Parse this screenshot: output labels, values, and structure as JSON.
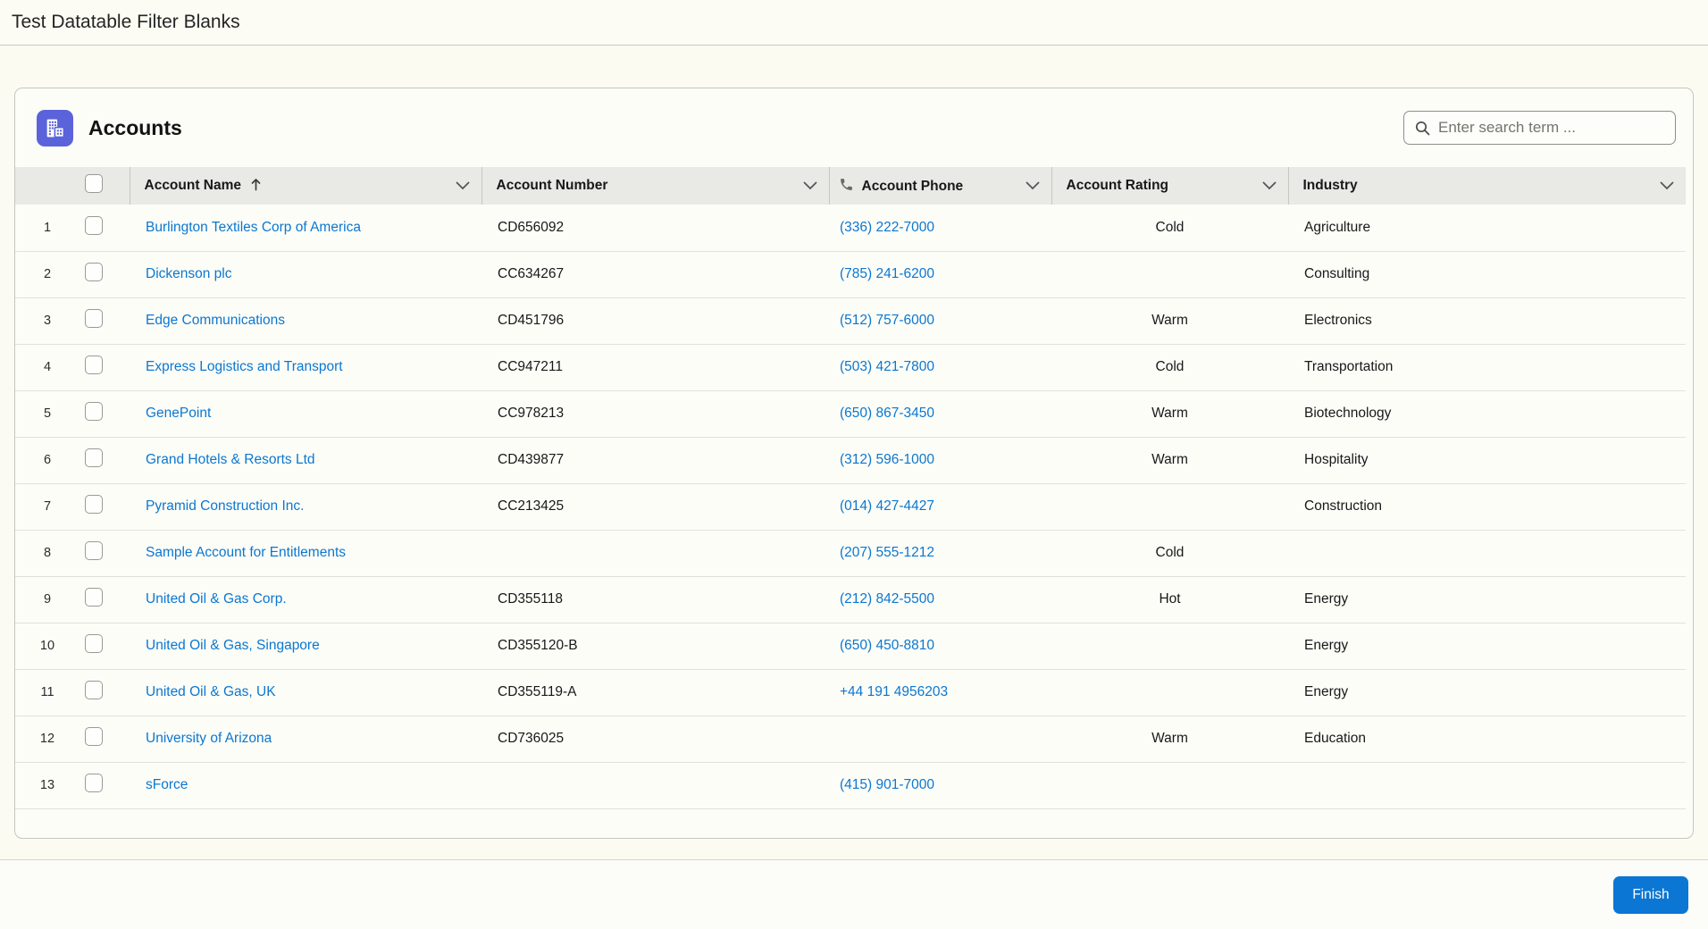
{
  "page": {
    "title": "Test Datatable Filter Blanks"
  },
  "card": {
    "title": "Accounts",
    "icon": "accounts-buildings-icon",
    "icon_bg_color": "#5b63db",
    "search_placeholder": "Enter search term ..."
  },
  "table": {
    "columns": [
      {
        "key": "name",
        "label": "Account Name",
        "sorted": "ascending",
        "icon": "sort-ascending-icon"
      },
      {
        "key": "number",
        "label": "Account Number"
      },
      {
        "key": "phone",
        "label": "Account Phone",
        "icon": "phone-icon"
      },
      {
        "key": "rating",
        "label": "Account Rating"
      },
      {
        "key": "industry",
        "label": "Industry"
      }
    ],
    "rows": [
      {
        "num": "1",
        "name": "Burlington Textiles Corp of America",
        "number": "CD656092",
        "phone": "(336) 222-7000",
        "rating": "Cold",
        "industry": "Agriculture"
      },
      {
        "num": "2",
        "name": "Dickenson plc",
        "number": "CC634267",
        "phone": "(785) 241-6200",
        "rating": "",
        "industry": "Consulting"
      },
      {
        "num": "3",
        "name": "Edge Communications",
        "number": "CD451796",
        "phone": "(512) 757-6000",
        "rating": "Warm",
        "industry": "Electronics"
      },
      {
        "num": "4",
        "name": "Express Logistics and Transport",
        "number": "CC947211",
        "phone": "(503) 421-7800",
        "rating": "Cold",
        "industry": "Transportation"
      },
      {
        "num": "5",
        "name": "GenePoint",
        "number": "CC978213",
        "phone": "(650) 867-3450",
        "rating": "Warm",
        "industry": "Biotechnology"
      },
      {
        "num": "6",
        "name": "Grand Hotels & Resorts Ltd",
        "number": "CD439877",
        "phone": "(312) 596-1000",
        "rating": "Warm",
        "industry": "Hospitality"
      },
      {
        "num": "7",
        "name": "Pyramid Construction Inc.",
        "number": "CC213425",
        "phone": "(014) 427-4427",
        "rating": "",
        "industry": "Construction"
      },
      {
        "num": "8",
        "name": "Sample Account for Entitlements",
        "number": "",
        "phone": "(207) 555-1212",
        "rating": "Cold",
        "industry": ""
      },
      {
        "num": "9",
        "name": "United Oil & Gas Corp.",
        "number": "CD355118",
        "phone": "(212) 842-5500",
        "rating": "Hot",
        "industry": "Energy"
      },
      {
        "num": "10",
        "name": "United Oil & Gas, Singapore",
        "number": "CD355120-B",
        "phone": "(650) 450-8810",
        "rating": "",
        "industry": "Energy"
      },
      {
        "num": "11",
        "name": "United Oil & Gas, UK",
        "number": "CD355119-A",
        "phone": "+44 191 4956203",
        "rating": "",
        "industry": "Energy"
      },
      {
        "num": "12",
        "name": "University of Arizona",
        "number": "CD736025",
        "phone": "",
        "rating": "Warm",
        "industry": "Education"
      },
      {
        "num": "13",
        "name": "sForce",
        "number": "",
        "phone": "(415) 901-7000",
        "rating": "",
        "industry": ""
      }
    ]
  },
  "footer": {
    "finish_label": "Finish"
  },
  "colors": {
    "accent_button": "#0b76d3",
    "link": "#0b77d0",
    "object_icon_bg": "#5b63db",
    "header_row_bg": "#e9e9e5"
  }
}
